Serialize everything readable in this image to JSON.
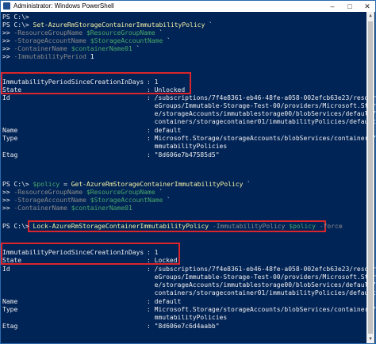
{
  "window": {
    "title": "Administrator: Windows PowerShell",
    "minimize": "–",
    "maximize": "□",
    "close": "✕"
  },
  "console": {
    "l0": "PS C:\\>",
    "l1_prompt": "PS C:\\> ",
    "l1_cmd": "Set-AzureRmStorageContainerImmutabilityPolicy",
    "l1_tail": " `",
    "l2_prefix": ">> ",
    "l2_param": "-ResourceGroupName ",
    "l2_var": "$ResourceGroupName",
    "l2_tail": " `",
    "l3_prefix": ">> ",
    "l3_param": "-StorageAccountName ",
    "l3_var": "$StorageAccountName",
    "l3_tail": " `",
    "l4_prefix": ">> ",
    "l4_param": "-ContainerName ",
    "l4_var": "$containerName01",
    "l4_tail": " `",
    "l5_prefix": ">> ",
    "l5_param": "-ImmutabilityPeriod ",
    "l5_num": "1",
    "block1": {
      "p_period": "ImmutabilityPeriodSinceCreationInDays",
      "v_period": ": 1",
      "p_state": "State",
      "v_state": ": Unlocked",
      "p_id": "Id",
      "v_id1": ": /subscriptions/7f4e8361-eb46-48fe-a058-002efcb63e23/resource",
      "v_id2": "  eGroups/Immutable-Storage-Test-00/providers/Microsoft.Storag",
      "v_id3": "  e/storageAccounts/immutablestorage00/blobServices/default/",
      "v_id4": "  containers/storagecontainer01/immutabilityPolicies/default",
      "p_name": "Name",
      "v_name": ": default",
      "p_type": "Type",
      "v_type1": ": Microsoft.Storage/storageAccounts/blobServices/containers/i",
      "v_type2": "  mmutabilityPolicies",
      "p_etag": "Etag",
      "v_etag": ": \"8d606e7b47585d5\""
    },
    "l6_prompt": "PS C:\\> ",
    "l6_var": "$policy",
    "l6_eq": " = ",
    "l6_cmd": "Get-AzureRmStorageContainerImmutabilityPolicy",
    "l6_tail": " `",
    "l7_prefix": ">> ",
    "l7_param": "-ResourceGroupName ",
    "l7_var": "$ResourceGroupName",
    "l7_tail": " `",
    "l8_prefix": ">> ",
    "l8_param": "-StorageAccountName ",
    "l8_var": "$StorageAccountName",
    "l8_tail": " `",
    "l9_prefix": ">> ",
    "l9_param": "-ContainerName ",
    "l9_var": "$containerName01",
    "l10_prompt": "PS C:\\> ",
    "l10_cmd": "Lock-AzureRmStorageContainerImmutabilityPolicy",
    "l10_param1": " -ImmutabilityPolicy ",
    "l10_var": "$policy",
    "l10_param2": " -force",
    "block2": {
      "p_period": "ImmutabilityPeriodSinceCreationInDays",
      "v_period": ": 1",
      "p_state": "State",
      "v_state": ": Locked",
      "p_id": "Id",
      "v_id1": ": /subscriptions/7f4e8361-eb46-48fe-a058-002efcb63e23/resource",
      "v_id2": "  eGroups/Immutable-Storage-Test-00/providers/Microsoft.Storag",
      "v_id3": "  e/storageAccounts/immutablestorage00/blobServices/default/",
      "v_id4": "  containers/storagecontainer01/immutabilityPolicies/default",
      "p_name": "Name",
      "v_name": ": default",
      "p_type": "Type",
      "v_type1": ": Microsoft.Storage/storageAccounts/blobServices/containers/i",
      "v_type2": "  mmutabilityPolicies",
      "p_etag": "Etag",
      "v_etag": ": \"8d606e7c6d4aabb\""
    }
  },
  "colors": {
    "background": "#012456",
    "highlight": "#d9252b",
    "command": "#f5f1a6",
    "parameter": "#8a8a8a",
    "variable": "#4aa86b"
  }
}
